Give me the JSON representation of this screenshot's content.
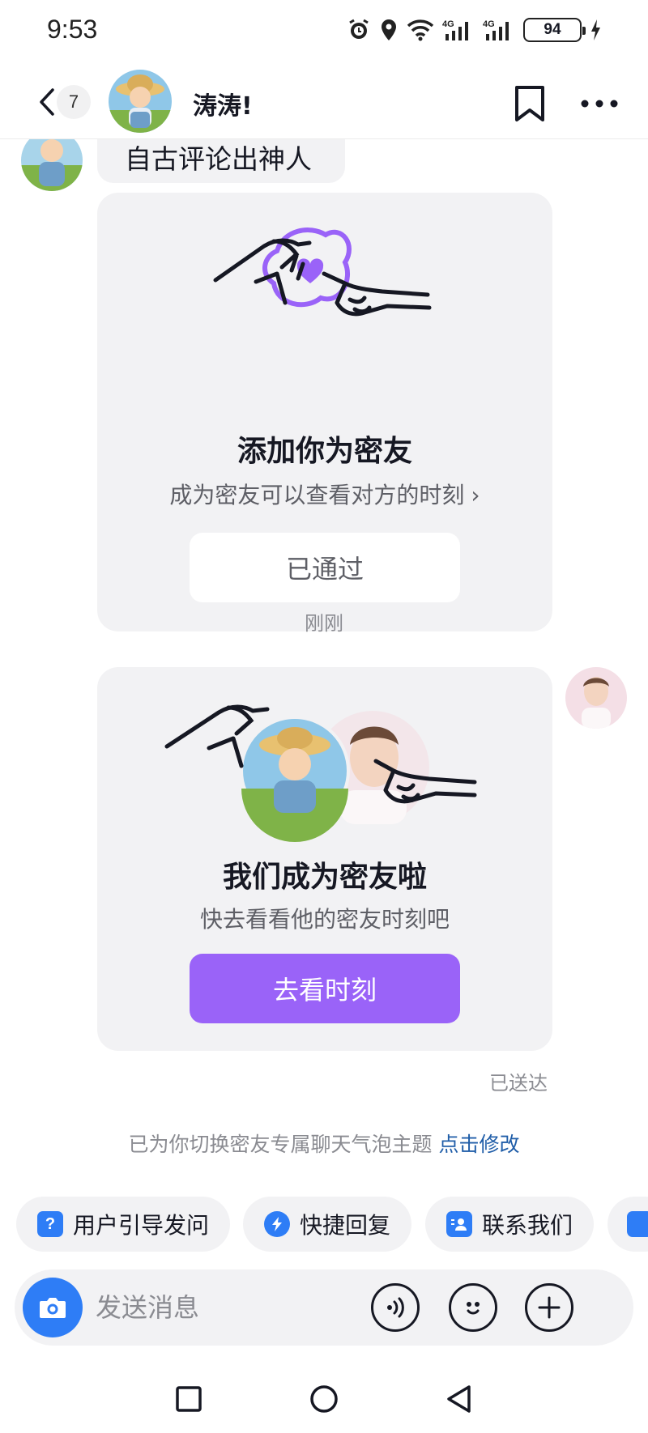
{
  "status_bar": {
    "time": "9:53",
    "battery": "94"
  },
  "header": {
    "unread_count": "7",
    "contact_name": "涛涛!"
  },
  "chat": {
    "text_message": "自古评论出神人",
    "friend_request_card": {
      "title": "添加你为密友",
      "subtitle": "成为密友可以查看对方的时刻",
      "chevron": "›",
      "button_label": "已通过"
    },
    "timestamp": "刚刚",
    "became_friends_card": {
      "title": "我们成为密友啦",
      "subtitle": "快去看看他的密友时刻吧",
      "button_label": "去看时刻"
    },
    "delivery_status": "已送达",
    "system_notice": "已为你切换密友专属聊天气泡主题",
    "system_notice_link": "点击修改"
  },
  "quick_replies": [
    {
      "label": "用户引导发问",
      "icon": "question-icon"
    },
    {
      "label": "快捷回复",
      "icon": "lightning-icon"
    },
    {
      "label": "联系我们",
      "icon": "contacts-icon"
    }
  ],
  "input": {
    "placeholder": "发送消息"
  },
  "colors": {
    "accent_purple": "#9a63f8",
    "brand_blue": "#2e7df6",
    "link_blue": "#1f5da8",
    "bubble_gray": "#f2f2f4"
  }
}
